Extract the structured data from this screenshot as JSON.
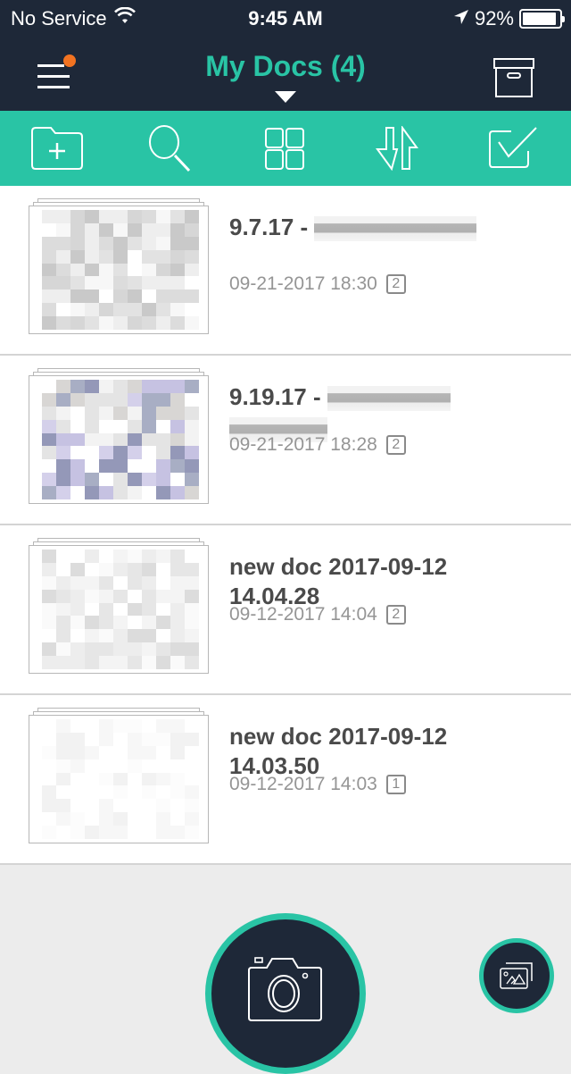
{
  "status_bar": {
    "carrier": "No Service",
    "time": "9:45 AM",
    "battery_percent": "92%",
    "battery_level": 0.92
  },
  "nav": {
    "title": "My Docs (4)",
    "menu_icon": "hamburger-menu-icon",
    "has_notification": true,
    "archive_icon": "archive-box-icon"
  },
  "toolbar": {
    "items": [
      {
        "name": "new-folder",
        "icon": "folder-plus-icon"
      },
      {
        "name": "search",
        "icon": "search-icon"
      },
      {
        "name": "grid-view",
        "icon": "grid-icon"
      },
      {
        "name": "sort",
        "icon": "sort-arrows-icon"
      },
      {
        "name": "select",
        "icon": "checkbox-icon"
      }
    ]
  },
  "colors": {
    "accent": "#29c4a5",
    "dark": "#1e2838",
    "notification": "#f27321",
    "title_text": "#4a4a4a",
    "meta_text": "#959595"
  },
  "documents": [
    {
      "title_visible": "9.7.17 -",
      "title_redacted": true,
      "date": "09-21-2017 18:30",
      "pages": "2"
    },
    {
      "title_visible": "9.19.17 -",
      "title_redacted": true,
      "date": "09-21-2017 18:28",
      "pages": "2"
    },
    {
      "title_visible": "new doc 2017-09-12 14.04.28",
      "title_redacted": false,
      "date": "09-12-2017 14:04",
      "pages": "2"
    },
    {
      "title_visible": "new doc 2017-09-12 14.03.50",
      "title_redacted": false,
      "date": "09-12-2017 14:03",
      "pages": "1"
    }
  ],
  "bottom": {
    "camera_icon": "camera-icon",
    "gallery_icon": "gallery-import-icon"
  }
}
